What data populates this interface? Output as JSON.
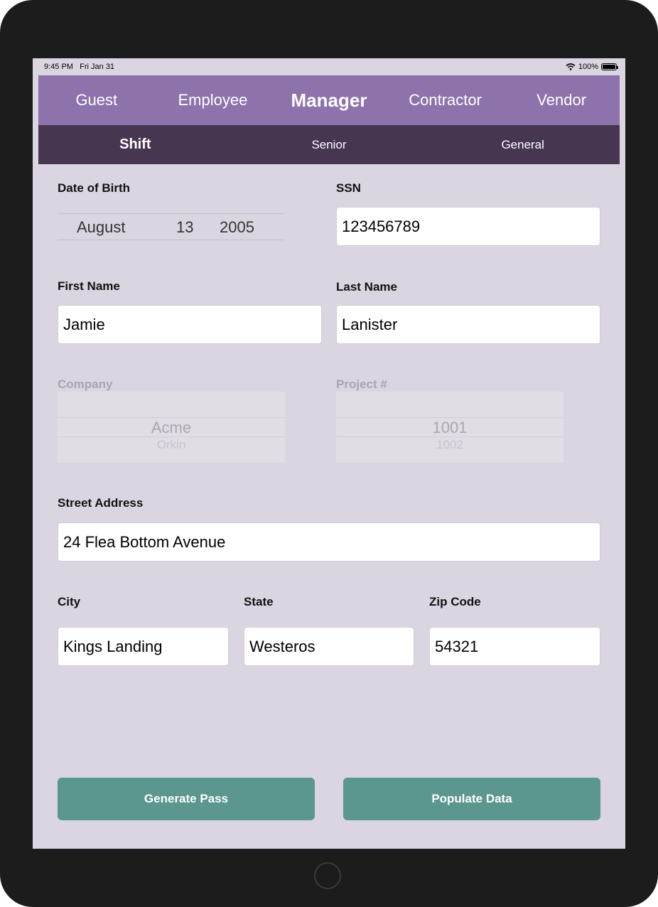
{
  "status_bar": {
    "time": "9:45 PM",
    "date": "Fri Jan 31",
    "battery": "100%"
  },
  "main_nav": [
    {
      "label": "Guest",
      "active": false
    },
    {
      "label": "Employee",
      "active": false
    },
    {
      "label": "Manager",
      "active": true
    },
    {
      "label": "Contractor",
      "active": false
    },
    {
      "label": "Vendor",
      "active": false
    }
  ],
  "sub_nav": [
    {
      "label": "Shift",
      "active": true
    },
    {
      "label": "Senior",
      "active": false
    },
    {
      "label": "General",
      "active": false
    }
  ],
  "form": {
    "dob": {
      "label": "Date of Birth",
      "month": "August",
      "day": "13",
      "year": "2005"
    },
    "ssn": {
      "label": "SSN",
      "value": "123456789"
    },
    "first_name": {
      "label": "First Name",
      "value": "Jamie"
    },
    "last_name": {
      "label": "Last Name",
      "value": "Lanister"
    },
    "company": {
      "label": "Company",
      "selected": "Acme",
      "next": "Orkin",
      "enabled": false
    },
    "project": {
      "label": "Project #",
      "selected": "1001",
      "next": "1002",
      "enabled": false
    },
    "street": {
      "label": "Street Address",
      "value": "24 Flea Bottom Avenue"
    },
    "city": {
      "label": "City",
      "value": "Kings Landing"
    },
    "state": {
      "label": "State",
      "value": "Westeros"
    },
    "zip": {
      "label": "Zip Code",
      "value": "54321"
    }
  },
  "buttons": {
    "generate": "Generate Pass",
    "populate": "Populate Data"
  },
  "colors": {
    "main_nav_bg": "#8e72ac",
    "sub_nav_bg": "#473650",
    "screen_bg": "#dbd5e1",
    "button_bg": "#5b978f"
  }
}
